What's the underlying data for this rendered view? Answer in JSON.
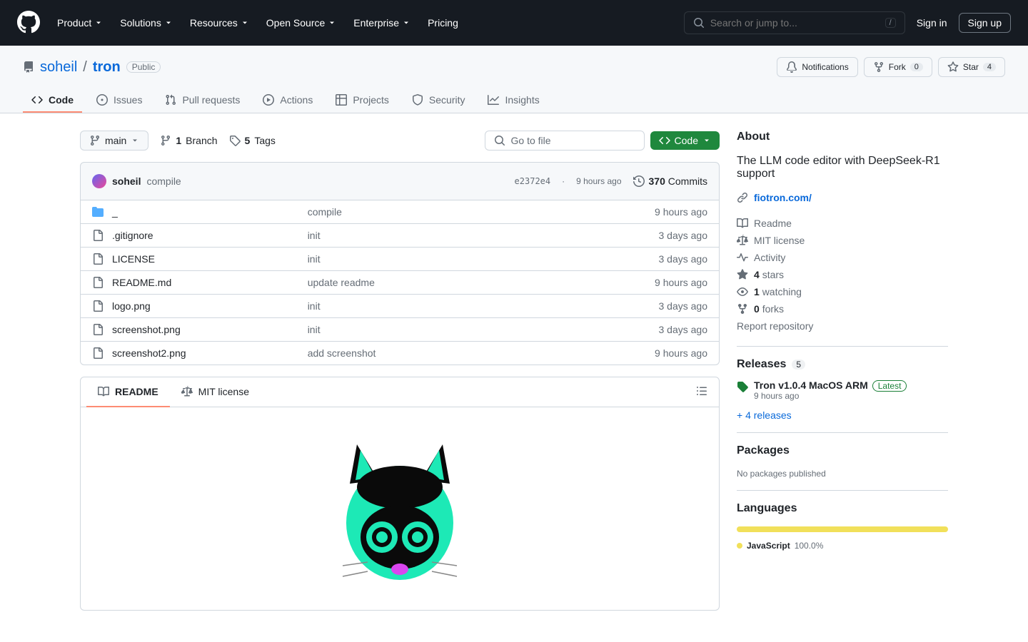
{
  "header": {
    "nav": [
      "Product",
      "Solutions",
      "Resources",
      "Open Source",
      "Enterprise",
      "Pricing"
    ],
    "search_placeholder": "Search or jump to...",
    "signin": "Sign in",
    "signup": "Sign up"
  },
  "repo": {
    "owner": "soheil",
    "name": "tron",
    "visibility": "Public",
    "notifications": "Notifications",
    "fork_label": "Fork",
    "fork_count": "0",
    "star_label": "Star",
    "star_count": "4"
  },
  "tabs": [
    "Code",
    "Issues",
    "Pull requests",
    "Actions",
    "Projects",
    "Security",
    "Insights"
  ],
  "branch": {
    "current": "main",
    "branch_count": "1",
    "branch_label": "Branch",
    "tag_count": "5",
    "tag_label": "Tags",
    "goto_file": "Go to file",
    "code_btn": "Code"
  },
  "commit": {
    "author": "soheil",
    "message": "compile",
    "sha": "e2372e4",
    "time": "9 hours ago",
    "commits_count": "370",
    "commits_label": "Commits"
  },
  "files": [
    {
      "type": "dir",
      "name": "_",
      "msg": "compile",
      "time": "9 hours ago"
    },
    {
      "type": "file",
      "name": ".gitignore",
      "msg": "init",
      "time": "3 days ago"
    },
    {
      "type": "file",
      "name": "LICENSE",
      "msg": "init",
      "time": "3 days ago"
    },
    {
      "type": "file",
      "name": "README.md",
      "msg": "update readme",
      "time": "9 hours ago"
    },
    {
      "type": "file",
      "name": "logo.png",
      "msg": "init",
      "time": "3 days ago"
    },
    {
      "type": "file",
      "name": "screenshot.png",
      "msg": "init",
      "time": "3 days ago"
    },
    {
      "type": "file",
      "name": "screenshot2.png",
      "msg": "add screenshot",
      "time": "9 hours ago"
    }
  ],
  "readme": {
    "tab_readme": "README",
    "tab_license": "MIT license"
  },
  "about": {
    "title": "About",
    "description": "The LLM code editor with DeepSeek-R1 support",
    "link": "fiotron.com/",
    "items": {
      "readme": "Readme",
      "license": "MIT license",
      "activity": "Activity",
      "stars_count": "4",
      "stars_label": "stars",
      "watching_count": "1",
      "watching_label": "watching",
      "forks_count": "0",
      "forks_label": "forks",
      "report": "Report repository"
    }
  },
  "releases": {
    "title": "Releases",
    "count": "5",
    "latest_name": "Tron v1.0.4 MacOS ARM",
    "latest_badge": "Latest",
    "latest_time": "9 hours ago",
    "more": "+ 4 releases"
  },
  "packages": {
    "title": "Packages",
    "none": "No packages published"
  },
  "languages": {
    "title": "Languages",
    "name": "JavaScript",
    "pct": "100.0%"
  }
}
